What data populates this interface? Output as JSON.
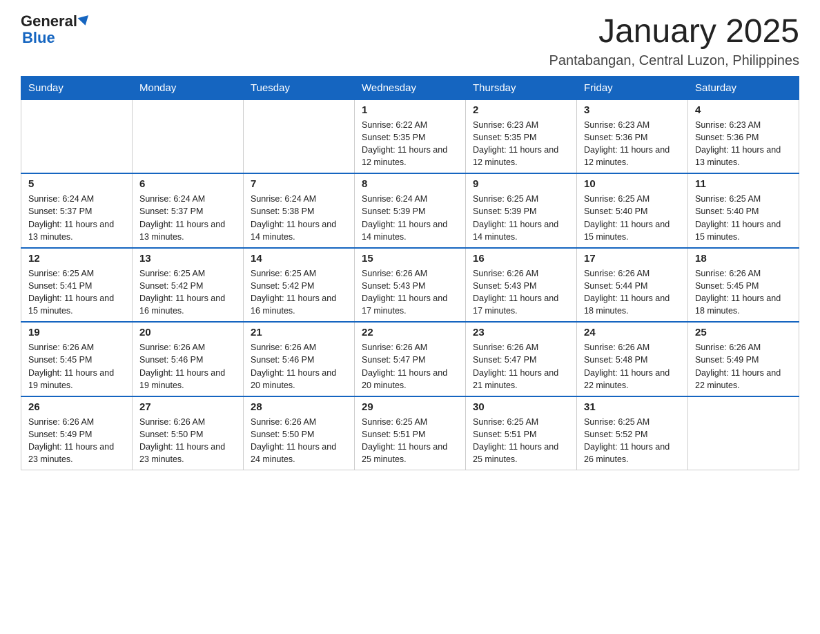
{
  "logo": {
    "general": "General",
    "blue": "Blue"
  },
  "title": "January 2025",
  "subtitle": "Pantabangan, Central Luzon, Philippines",
  "headers": [
    "Sunday",
    "Monday",
    "Tuesday",
    "Wednesday",
    "Thursday",
    "Friday",
    "Saturday"
  ],
  "weeks": [
    [
      {
        "day": "",
        "info": ""
      },
      {
        "day": "",
        "info": ""
      },
      {
        "day": "",
        "info": ""
      },
      {
        "day": "1",
        "info": "Sunrise: 6:22 AM\nSunset: 5:35 PM\nDaylight: 11 hours and 12 minutes."
      },
      {
        "day": "2",
        "info": "Sunrise: 6:23 AM\nSunset: 5:35 PM\nDaylight: 11 hours and 12 minutes."
      },
      {
        "day": "3",
        "info": "Sunrise: 6:23 AM\nSunset: 5:36 PM\nDaylight: 11 hours and 12 minutes."
      },
      {
        "day": "4",
        "info": "Sunrise: 6:23 AM\nSunset: 5:36 PM\nDaylight: 11 hours and 13 minutes."
      }
    ],
    [
      {
        "day": "5",
        "info": "Sunrise: 6:24 AM\nSunset: 5:37 PM\nDaylight: 11 hours and 13 minutes."
      },
      {
        "day": "6",
        "info": "Sunrise: 6:24 AM\nSunset: 5:37 PM\nDaylight: 11 hours and 13 minutes."
      },
      {
        "day": "7",
        "info": "Sunrise: 6:24 AM\nSunset: 5:38 PM\nDaylight: 11 hours and 14 minutes."
      },
      {
        "day": "8",
        "info": "Sunrise: 6:24 AM\nSunset: 5:39 PM\nDaylight: 11 hours and 14 minutes."
      },
      {
        "day": "9",
        "info": "Sunrise: 6:25 AM\nSunset: 5:39 PM\nDaylight: 11 hours and 14 minutes."
      },
      {
        "day": "10",
        "info": "Sunrise: 6:25 AM\nSunset: 5:40 PM\nDaylight: 11 hours and 15 minutes."
      },
      {
        "day": "11",
        "info": "Sunrise: 6:25 AM\nSunset: 5:40 PM\nDaylight: 11 hours and 15 minutes."
      }
    ],
    [
      {
        "day": "12",
        "info": "Sunrise: 6:25 AM\nSunset: 5:41 PM\nDaylight: 11 hours and 15 minutes."
      },
      {
        "day": "13",
        "info": "Sunrise: 6:25 AM\nSunset: 5:42 PM\nDaylight: 11 hours and 16 minutes."
      },
      {
        "day": "14",
        "info": "Sunrise: 6:25 AM\nSunset: 5:42 PM\nDaylight: 11 hours and 16 minutes."
      },
      {
        "day": "15",
        "info": "Sunrise: 6:26 AM\nSunset: 5:43 PM\nDaylight: 11 hours and 17 minutes."
      },
      {
        "day": "16",
        "info": "Sunrise: 6:26 AM\nSunset: 5:43 PM\nDaylight: 11 hours and 17 minutes."
      },
      {
        "day": "17",
        "info": "Sunrise: 6:26 AM\nSunset: 5:44 PM\nDaylight: 11 hours and 18 minutes."
      },
      {
        "day": "18",
        "info": "Sunrise: 6:26 AM\nSunset: 5:45 PM\nDaylight: 11 hours and 18 minutes."
      }
    ],
    [
      {
        "day": "19",
        "info": "Sunrise: 6:26 AM\nSunset: 5:45 PM\nDaylight: 11 hours and 19 minutes."
      },
      {
        "day": "20",
        "info": "Sunrise: 6:26 AM\nSunset: 5:46 PM\nDaylight: 11 hours and 19 minutes."
      },
      {
        "day": "21",
        "info": "Sunrise: 6:26 AM\nSunset: 5:46 PM\nDaylight: 11 hours and 20 minutes."
      },
      {
        "day": "22",
        "info": "Sunrise: 6:26 AM\nSunset: 5:47 PM\nDaylight: 11 hours and 20 minutes."
      },
      {
        "day": "23",
        "info": "Sunrise: 6:26 AM\nSunset: 5:47 PM\nDaylight: 11 hours and 21 minutes."
      },
      {
        "day": "24",
        "info": "Sunrise: 6:26 AM\nSunset: 5:48 PM\nDaylight: 11 hours and 22 minutes."
      },
      {
        "day": "25",
        "info": "Sunrise: 6:26 AM\nSunset: 5:49 PM\nDaylight: 11 hours and 22 minutes."
      }
    ],
    [
      {
        "day": "26",
        "info": "Sunrise: 6:26 AM\nSunset: 5:49 PM\nDaylight: 11 hours and 23 minutes."
      },
      {
        "day": "27",
        "info": "Sunrise: 6:26 AM\nSunset: 5:50 PM\nDaylight: 11 hours and 23 minutes."
      },
      {
        "day": "28",
        "info": "Sunrise: 6:26 AM\nSunset: 5:50 PM\nDaylight: 11 hours and 24 minutes."
      },
      {
        "day": "29",
        "info": "Sunrise: 6:25 AM\nSunset: 5:51 PM\nDaylight: 11 hours and 25 minutes."
      },
      {
        "day": "30",
        "info": "Sunrise: 6:25 AM\nSunset: 5:51 PM\nDaylight: 11 hours and 25 minutes."
      },
      {
        "day": "31",
        "info": "Sunrise: 6:25 AM\nSunset: 5:52 PM\nDaylight: 11 hours and 26 minutes."
      },
      {
        "day": "",
        "info": ""
      }
    ]
  ]
}
